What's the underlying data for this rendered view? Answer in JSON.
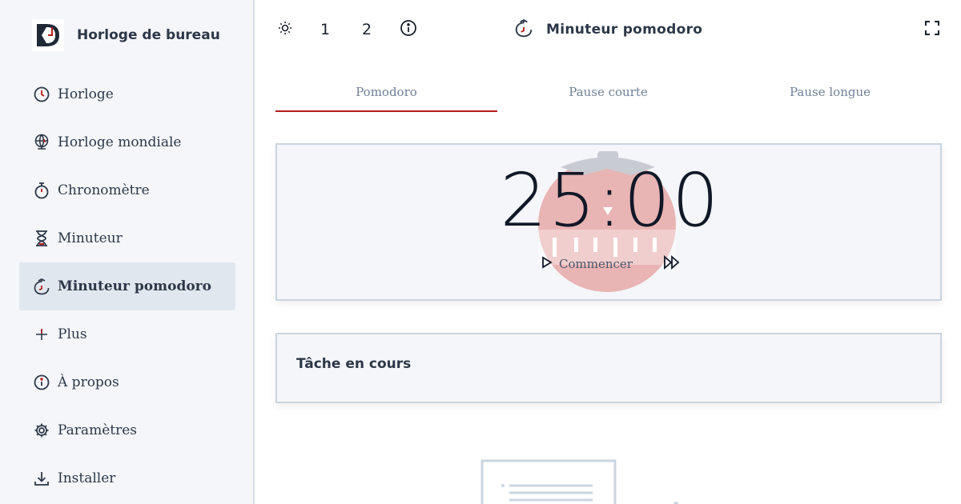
{
  "app": {
    "name": "Horloge de bureau"
  },
  "sidebar": {
    "items": [
      {
        "label": "Horloge",
        "icon": "clock-icon"
      },
      {
        "label": "Horloge mondiale",
        "icon": "world-clock-icon"
      },
      {
        "label": "Chronomètre",
        "icon": "stopwatch-icon"
      },
      {
        "label": "Minuteur",
        "icon": "hourglass-icon"
      },
      {
        "label": "Minuteur pomodoro",
        "icon": "pomodoro-icon",
        "active": true
      },
      {
        "label": "Plus",
        "icon": "plus-icon"
      },
      {
        "label": "À propos",
        "icon": "info-icon"
      },
      {
        "label": "Paramètres",
        "icon": "gear-icon"
      },
      {
        "label": "Installer",
        "icon": "download-icon"
      }
    ]
  },
  "topbar": {
    "theme_icon": "sun-icon",
    "btn1": "1",
    "btn2": "2",
    "info_icon": "info-icon",
    "title": "Minuteur pomodoro",
    "title_icon": "pomodoro-icon",
    "fullscreen_icon": "fullscreen-icon"
  },
  "tabs": [
    {
      "label": "Pomodoro",
      "active": true
    },
    {
      "label": "Pause courte"
    },
    {
      "label": "Pause longue"
    }
  ],
  "timer": {
    "time": "25:00",
    "start_label": "Commencer",
    "skip_icon": "fast-forward-icon"
  },
  "task": {
    "title": "Tâche en cours"
  },
  "colors": {
    "accent": "#b91c1c",
    "sidebar_bg": "#f4f6f9",
    "card_border": "#cbd5e0"
  }
}
